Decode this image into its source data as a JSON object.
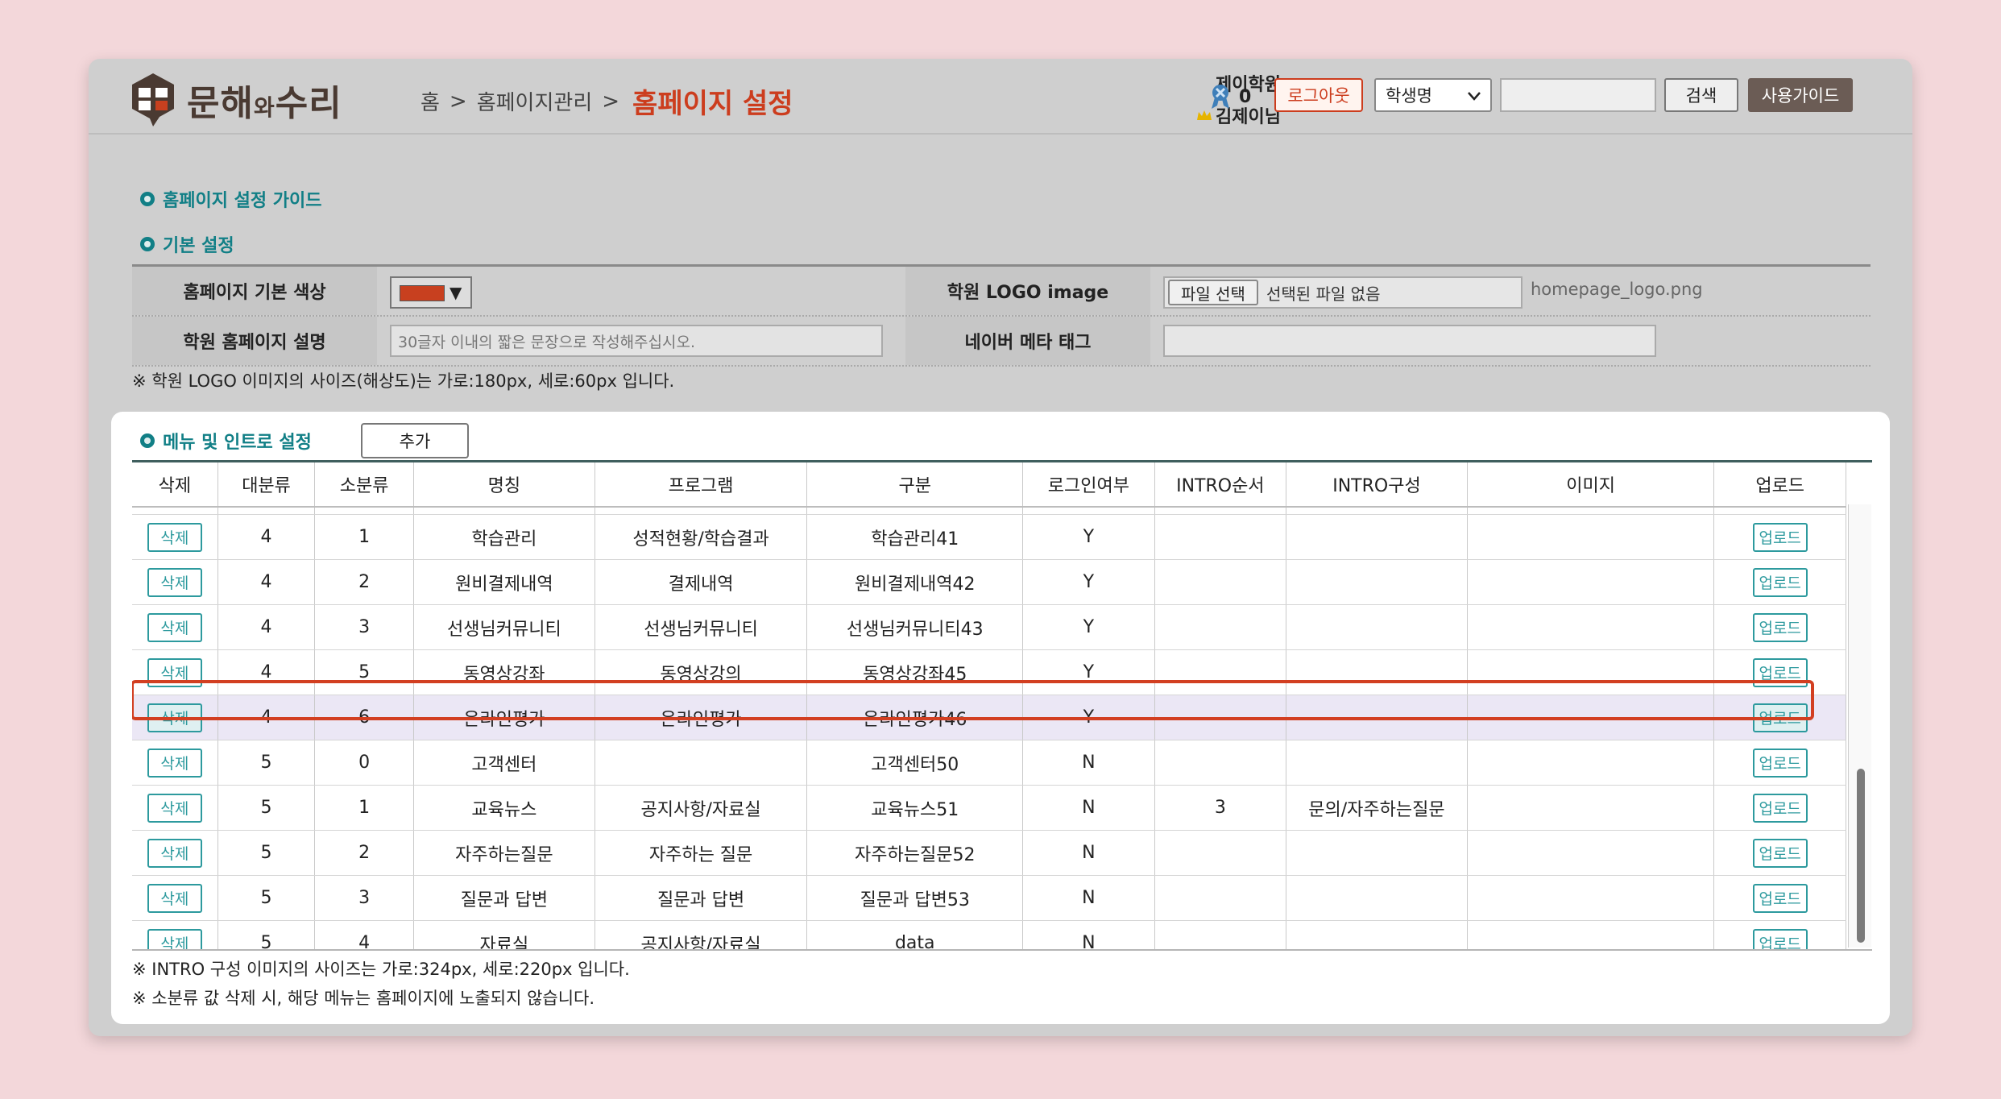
{
  "header": {
    "logo_text_1": "문해",
    "logo_text_2": "와",
    "logo_text_3": "수리",
    "breadcrumb": [
      "홈",
      "홈페이지관리"
    ],
    "breadcrumb_sep": ">",
    "page_title": "홈페이지 설정",
    "academy_name": "제이학원",
    "user_name": "김제이님",
    "badge_count": "0",
    "logout_label": "로그아웃",
    "student_select": "학생명",
    "search_value": "",
    "search_label": "검색",
    "guide_label": "사용가이드"
  },
  "sections": {
    "guide_title": "홈페이지 설정 가이드",
    "basic_title": "기본 설정",
    "menu_title": "메뉴 및 인트로 설정"
  },
  "basic": {
    "color_label": "홈페이지 기본 색상",
    "color_value": "#c8401f",
    "logo_label": "학원 LOGO image",
    "file_button": "파일 선택",
    "file_status": "선택된 파일 없음",
    "current_logo": "homepage_logo.png",
    "desc_label": "학원 홈페이지 설명",
    "desc_placeholder": "30글자 이내의 짧은 문장으로 작성해주십시오.",
    "meta_label": "네이버 메타 태그",
    "meta_value": "",
    "note": "※ 학원 LOGO 이미지의 사이즈(해상도)는 가로:180px, 세로:60px 입니다."
  },
  "menu": {
    "add_label": "추가",
    "columns": [
      "삭제",
      "대분류",
      "소분류",
      "명칭",
      "프로그램",
      "구분",
      "로그인여부",
      "INTRO순서",
      "INTRO구성",
      "이미지",
      "업로드"
    ],
    "delete_label": "삭제",
    "upload_label": "업로드",
    "rows": [
      {
        "major": "4",
        "minor": "1",
        "name": "학습관리",
        "program": "성적현황/학습결과",
        "type": "학습관리41",
        "login": "Y",
        "intro_order": "",
        "intro_comp": "",
        "image": "",
        "highlighted": false
      },
      {
        "major": "4",
        "minor": "2",
        "name": "원비결제내역",
        "program": "결제내역",
        "type": "원비결제내역42",
        "login": "Y",
        "intro_order": "",
        "intro_comp": "",
        "image": "",
        "highlighted": false
      },
      {
        "major": "4",
        "minor": "3",
        "name": "선생님커뮤니티",
        "program": "선생님커뮤니티",
        "type": "선생님커뮤니티43",
        "login": "Y",
        "intro_order": "",
        "intro_comp": "",
        "image": "",
        "highlighted": false
      },
      {
        "major": "4",
        "minor": "5",
        "name": "동영상강좌",
        "program": "동영상강의",
        "type": "동영상강좌45",
        "login": "Y",
        "intro_order": "",
        "intro_comp": "",
        "image": "",
        "highlighted": false
      },
      {
        "major": "4",
        "minor": "6",
        "name": "온라인평가",
        "program": "온라인평가",
        "type": "온라인평가46",
        "login": "Y",
        "intro_order": "",
        "intro_comp": "",
        "image": "",
        "highlighted": true
      },
      {
        "major": "5",
        "minor": "0",
        "name": "고객센터",
        "program": "",
        "type": "고객센터50",
        "login": "N",
        "intro_order": "",
        "intro_comp": "",
        "image": "",
        "highlighted": false
      },
      {
        "major": "5",
        "minor": "1",
        "name": "교육뉴스",
        "program": "공지사항/자료실",
        "type": "교육뉴스51",
        "login": "N",
        "intro_order": "3",
        "intro_comp": "문의/자주하는질문",
        "image": "",
        "highlighted": false
      },
      {
        "major": "5",
        "minor": "2",
        "name": "자주하는질문",
        "program": "자주하는 질문",
        "type": "자주하는질문52",
        "login": "N",
        "intro_order": "",
        "intro_comp": "",
        "image": "",
        "highlighted": false
      },
      {
        "major": "5",
        "minor": "3",
        "name": "질문과 답변",
        "program": "질문과 답변",
        "type": "질문과 답변53",
        "login": "N",
        "intro_order": "",
        "intro_comp": "",
        "image": "",
        "highlighted": false
      },
      {
        "major": "5",
        "minor": "4",
        "name": "자료실",
        "program": "공지사항/자료실",
        "type": "data",
        "login": "N",
        "intro_order": "",
        "intro_comp": "",
        "image": "",
        "highlighted": false
      }
    ],
    "note_1": "※ INTRO 구성 이미지의 사이즈는 가로:324px, 세로:220px 입니다.",
    "note_2": "※ 소분류 값 삭제 시, 해당 메뉴는 홈페이지에 노출되지 않습니다."
  },
  "icons": {
    "logo": "book-speech-bubble-icon",
    "crown": "crown-icon",
    "badge": "ribbon-badge-icon",
    "select": "chevron-down-icon",
    "color": "triangle-down-icon",
    "section": "circle-bullet-icon"
  },
  "colors": {
    "accent": "#cc3d1e",
    "teal": "#117f86",
    "highlight_row": "#ebe7f5",
    "guide_button": "#6b5c55"
  }
}
